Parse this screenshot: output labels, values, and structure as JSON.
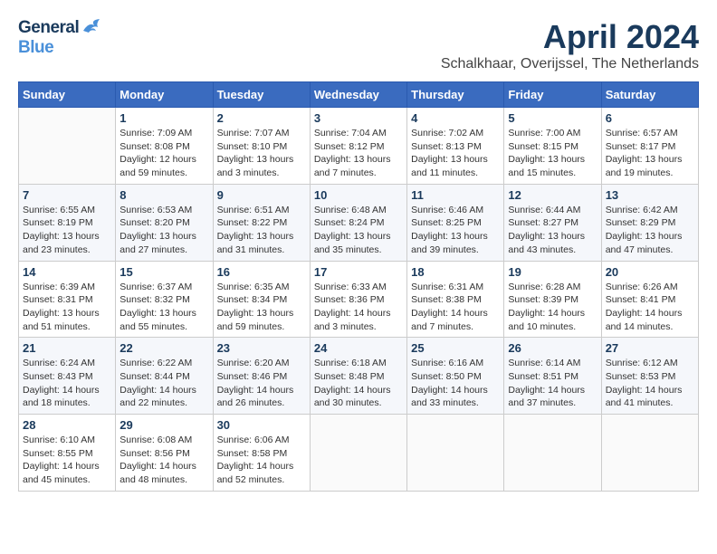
{
  "header": {
    "logo_general": "General",
    "logo_blue": "Blue",
    "month": "April 2024",
    "location": "Schalkhaar, Overijssel, The Netherlands"
  },
  "weekdays": [
    "Sunday",
    "Monday",
    "Tuesday",
    "Wednesday",
    "Thursday",
    "Friday",
    "Saturday"
  ],
  "weeks": [
    [
      {
        "day": "",
        "sunrise": "",
        "sunset": "",
        "daylight": ""
      },
      {
        "day": "1",
        "sunrise": "Sunrise: 7:09 AM",
        "sunset": "Sunset: 8:08 PM",
        "daylight": "Daylight: 12 hours and 59 minutes."
      },
      {
        "day": "2",
        "sunrise": "Sunrise: 7:07 AM",
        "sunset": "Sunset: 8:10 PM",
        "daylight": "Daylight: 13 hours and 3 minutes."
      },
      {
        "day": "3",
        "sunrise": "Sunrise: 7:04 AM",
        "sunset": "Sunset: 8:12 PM",
        "daylight": "Daylight: 13 hours and 7 minutes."
      },
      {
        "day": "4",
        "sunrise": "Sunrise: 7:02 AM",
        "sunset": "Sunset: 8:13 PM",
        "daylight": "Daylight: 13 hours and 11 minutes."
      },
      {
        "day": "5",
        "sunrise": "Sunrise: 7:00 AM",
        "sunset": "Sunset: 8:15 PM",
        "daylight": "Daylight: 13 hours and 15 minutes."
      },
      {
        "day": "6",
        "sunrise": "Sunrise: 6:57 AM",
        "sunset": "Sunset: 8:17 PM",
        "daylight": "Daylight: 13 hours and 19 minutes."
      }
    ],
    [
      {
        "day": "7",
        "sunrise": "Sunrise: 6:55 AM",
        "sunset": "Sunset: 8:19 PM",
        "daylight": "Daylight: 13 hours and 23 minutes."
      },
      {
        "day": "8",
        "sunrise": "Sunrise: 6:53 AM",
        "sunset": "Sunset: 8:20 PM",
        "daylight": "Daylight: 13 hours and 27 minutes."
      },
      {
        "day": "9",
        "sunrise": "Sunrise: 6:51 AM",
        "sunset": "Sunset: 8:22 PM",
        "daylight": "Daylight: 13 hours and 31 minutes."
      },
      {
        "day": "10",
        "sunrise": "Sunrise: 6:48 AM",
        "sunset": "Sunset: 8:24 PM",
        "daylight": "Daylight: 13 hours and 35 minutes."
      },
      {
        "day": "11",
        "sunrise": "Sunrise: 6:46 AM",
        "sunset": "Sunset: 8:25 PM",
        "daylight": "Daylight: 13 hours and 39 minutes."
      },
      {
        "day": "12",
        "sunrise": "Sunrise: 6:44 AM",
        "sunset": "Sunset: 8:27 PM",
        "daylight": "Daylight: 13 hours and 43 minutes."
      },
      {
        "day": "13",
        "sunrise": "Sunrise: 6:42 AM",
        "sunset": "Sunset: 8:29 PM",
        "daylight": "Daylight: 13 hours and 47 minutes."
      }
    ],
    [
      {
        "day": "14",
        "sunrise": "Sunrise: 6:39 AM",
        "sunset": "Sunset: 8:31 PM",
        "daylight": "Daylight: 13 hours and 51 minutes."
      },
      {
        "day": "15",
        "sunrise": "Sunrise: 6:37 AM",
        "sunset": "Sunset: 8:32 PM",
        "daylight": "Daylight: 13 hours and 55 minutes."
      },
      {
        "day": "16",
        "sunrise": "Sunrise: 6:35 AM",
        "sunset": "Sunset: 8:34 PM",
        "daylight": "Daylight: 13 hours and 59 minutes."
      },
      {
        "day": "17",
        "sunrise": "Sunrise: 6:33 AM",
        "sunset": "Sunset: 8:36 PM",
        "daylight": "Daylight: 14 hours and 3 minutes."
      },
      {
        "day": "18",
        "sunrise": "Sunrise: 6:31 AM",
        "sunset": "Sunset: 8:38 PM",
        "daylight": "Daylight: 14 hours and 7 minutes."
      },
      {
        "day": "19",
        "sunrise": "Sunrise: 6:28 AM",
        "sunset": "Sunset: 8:39 PM",
        "daylight": "Daylight: 14 hours and 10 minutes."
      },
      {
        "day": "20",
        "sunrise": "Sunrise: 6:26 AM",
        "sunset": "Sunset: 8:41 PM",
        "daylight": "Daylight: 14 hours and 14 minutes."
      }
    ],
    [
      {
        "day": "21",
        "sunrise": "Sunrise: 6:24 AM",
        "sunset": "Sunset: 8:43 PM",
        "daylight": "Daylight: 14 hours and 18 minutes."
      },
      {
        "day": "22",
        "sunrise": "Sunrise: 6:22 AM",
        "sunset": "Sunset: 8:44 PM",
        "daylight": "Daylight: 14 hours and 22 minutes."
      },
      {
        "day": "23",
        "sunrise": "Sunrise: 6:20 AM",
        "sunset": "Sunset: 8:46 PM",
        "daylight": "Daylight: 14 hours and 26 minutes."
      },
      {
        "day": "24",
        "sunrise": "Sunrise: 6:18 AM",
        "sunset": "Sunset: 8:48 PM",
        "daylight": "Daylight: 14 hours and 30 minutes."
      },
      {
        "day": "25",
        "sunrise": "Sunrise: 6:16 AM",
        "sunset": "Sunset: 8:50 PM",
        "daylight": "Daylight: 14 hours and 33 minutes."
      },
      {
        "day": "26",
        "sunrise": "Sunrise: 6:14 AM",
        "sunset": "Sunset: 8:51 PM",
        "daylight": "Daylight: 14 hours and 37 minutes."
      },
      {
        "day": "27",
        "sunrise": "Sunrise: 6:12 AM",
        "sunset": "Sunset: 8:53 PM",
        "daylight": "Daylight: 14 hours and 41 minutes."
      }
    ],
    [
      {
        "day": "28",
        "sunrise": "Sunrise: 6:10 AM",
        "sunset": "Sunset: 8:55 PM",
        "daylight": "Daylight: 14 hours and 45 minutes."
      },
      {
        "day": "29",
        "sunrise": "Sunrise: 6:08 AM",
        "sunset": "Sunset: 8:56 PM",
        "daylight": "Daylight: 14 hours and 48 minutes."
      },
      {
        "day": "30",
        "sunrise": "Sunrise: 6:06 AM",
        "sunset": "Sunset: 8:58 PM",
        "daylight": "Daylight: 14 hours and 52 minutes."
      },
      {
        "day": "",
        "sunrise": "",
        "sunset": "",
        "daylight": ""
      },
      {
        "day": "",
        "sunrise": "",
        "sunset": "",
        "daylight": ""
      },
      {
        "day": "",
        "sunrise": "",
        "sunset": "",
        "daylight": ""
      },
      {
        "day": "",
        "sunrise": "",
        "sunset": "",
        "daylight": ""
      }
    ]
  ]
}
